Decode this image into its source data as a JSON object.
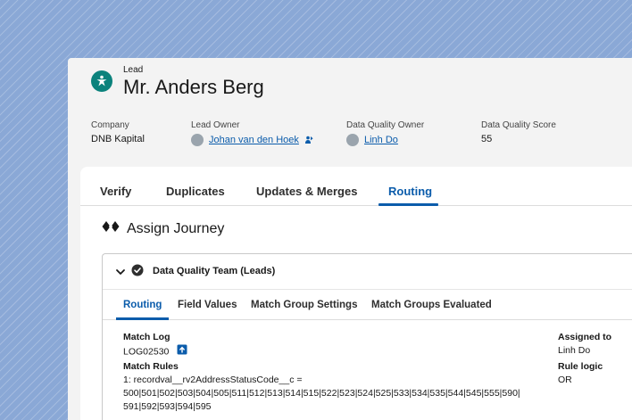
{
  "header": {
    "object_label": "Lead",
    "record_title": "Mr. Anders Berg",
    "fields": [
      {
        "label": "Company",
        "value": "DNB Kapital"
      },
      {
        "label": "Lead Owner",
        "value": "Johan van den Hoek"
      },
      {
        "label": "Data Quality Owner",
        "value": "Linh Do"
      },
      {
        "label": "Data Quality Score",
        "value": "55"
      }
    ]
  },
  "tabs": [
    {
      "label": "Verify"
    },
    {
      "label": "Duplicates"
    },
    {
      "label": "Updates & Merges"
    },
    {
      "label": "Routing",
      "active": true
    }
  ],
  "assign": {
    "title": "Assign Journey"
  },
  "section": {
    "title": "Data Quality Team (Leads)",
    "subtabs": [
      {
        "label": "Routing",
        "active": true
      },
      {
        "label": "Field Values"
      },
      {
        "label": "Match Group Settings"
      },
      {
        "label": "Match Groups Evaluated"
      }
    ],
    "match_log_label": "Match Log",
    "match_log_value": "LOG02530",
    "match_rules_label": "Match Rules",
    "match_rules_line1": "1: recordval__rv2AddressStatusCode__c =",
    "match_rules_line2": "500|501|502|503|504|505|511|512|513|514|515|522|523|524|525|533|534|535|544|545|555|590|",
    "match_rules_line3": "591|592|593|594|595",
    "assigned_to_label": "Assigned to",
    "assigned_to_value": "Linh Do",
    "rule_logic_label": "Rule logic",
    "rule_logic_value": "OR"
  },
  "colors": {
    "accent": "#0b5cab",
    "lead_icon": "#0b827c",
    "background": "#8aa8d6"
  }
}
